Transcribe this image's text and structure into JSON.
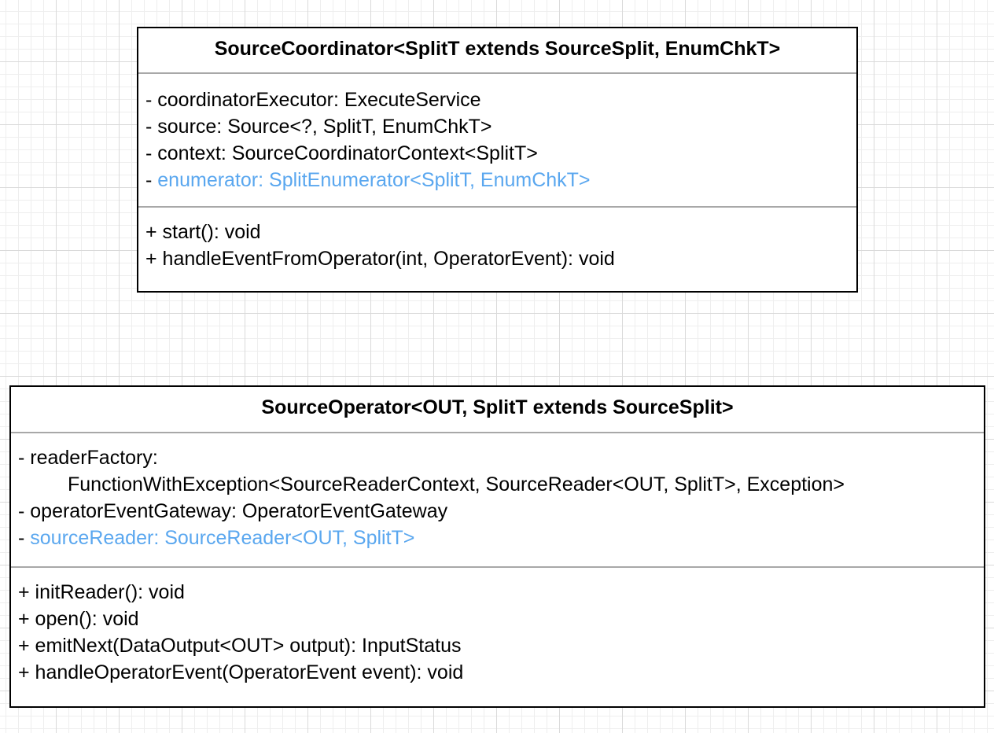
{
  "source_coordinator": {
    "title": "SourceCoordinator<SplitT extends SourceSplit, EnumChkT>",
    "attributes": [
      "- coordinatorExecutor: ExecuteService",
      "- source: Source<?, SplitT, EnumChkT>",
      "- context: SourceCoordinatorContext<SplitT>"
    ],
    "highlighted_attribute": {
      "prefix": "- ",
      "text": "enumerator: SplitEnumerator<SplitT, EnumChkT>"
    },
    "operations": [
      "+ start(): void",
      "+ handleEventFromOperator(int, OperatorEvent): void"
    ]
  },
  "source_operator": {
    "title": "SourceOperator<OUT, SplitT extends SourceSplit>",
    "attributes": [
      "- readerFactory:",
      "FunctionWithException<SourceReaderContext, SourceReader<OUT, SplitT>, Exception>",
      "- operatorEventGateway: OperatorEventGateway"
    ],
    "highlighted_attribute": {
      "prefix": "- ",
      "text": "sourceReader: SourceReader<OUT, SplitT>"
    },
    "operations": [
      "+ initReader(): void",
      "+ open(): void",
      "+ emitNext(DataOutput<OUT> output): InputStatus",
      "+ handleOperatorEvent(OperatorEvent event): void"
    ]
  },
  "colors": {
    "highlight": "#5aa7ef",
    "border": "#000000",
    "divider": "#a8a8a8",
    "grid": "#dadada"
  }
}
